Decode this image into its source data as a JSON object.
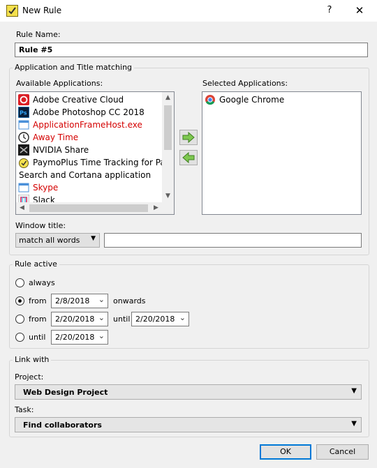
{
  "window": {
    "title": "New Rule",
    "help_glyph": "?",
    "close_glyph": "✕"
  },
  "rule_name": {
    "label": "Rule Name:",
    "value": "Rule #5"
  },
  "matching": {
    "group_title": "Application and Title matching",
    "available_label": "Available Applications:",
    "selected_label": "Selected Applications:",
    "available_apps": [
      {
        "name": "Adobe Creative Cloud",
        "icon": "adobe-cc-icon",
        "missing": false
      },
      {
        "name": "Adobe Photoshop CC 2018",
        "icon": "photoshop-icon",
        "missing": false
      },
      {
        "name": "ApplicationFrameHost.exe",
        "icon": "window-icon",
        "missing": true
      },
      {
        "name": "Away Time",
        "icon": "clock-icon",
        "missing": true
      },
      {
        "name": "NVIDIA Share",
        "icon": "nvidia-icon",
        "missing": false
      },
      {
        "name": "PaymoPlus Time Tracking for Payr",
        "icon": "paymo-icon",
        "missing": false
      },
      {
        "name": "Search and Cortana application",
        "icon": "",
        "missing": false
      },
      {
        "name": "Skype",
        "icon": "window-icon",
        "missing": true
      },
      {
        "name": "Slack",
        "icon": "slack-icon",
        "missing": false
      }
    ],
    "selected_apps": [
      {
        "name": "Google Chrome",
        "icon": "chrome-icon"
      }
    ],
    "window_title_label": "Window title:",
    "window_title_mode": "match all words",
    "window_title_value": ""
  },
  "rule_active": {
    "group_title": "Rule active",
    "always_label": "always",
    "from_label": "from",
    "from_date": "2/8/2018",
    "onwards_label": "onwards",
    "range_from_label": "from",
    "range_from_date": "2/20/2018",
    "until_word": "until",
    "range_until_date": "2/20/2018",
    "until_label": "until",
    "until_date": "2/20/2018"
  },
  "link_with": {
    "group_title": "Link with",
    "project_label": "Project:",
    "project_value": "Web Design Project",
    "task_label": "Task:",
    "task_value": "Find collaborators"
  },
  "footer": {
    "ok_label": "OK",
    "cancel_label": "Cancel"
  },
  "colors": {
    "missing_app": "#d40000",
    "default_button_border": "#0078d7"
  }
}
